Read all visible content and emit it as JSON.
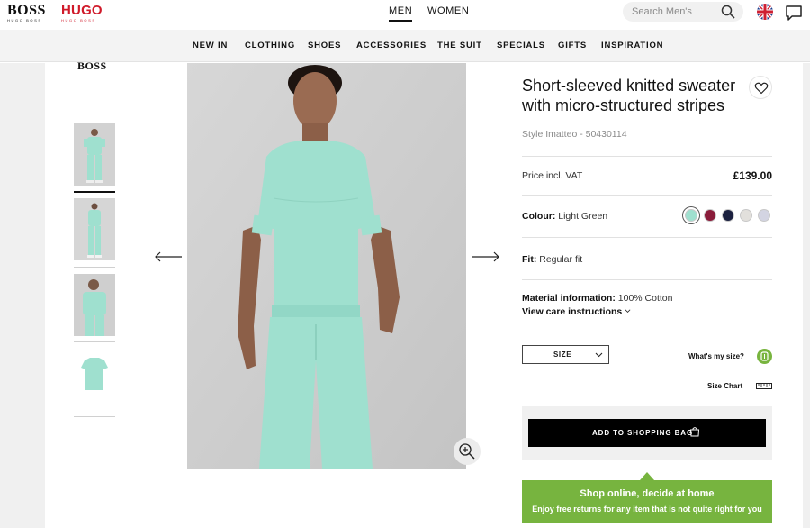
{
  "header": {
    "brand_boss": "BOSS",
    "brand_boss_sub": "HUGO BOSS",
    "brand_hugo": "HUGO",
    "brand_hugo_sub": "HUGO BOSS",
    "gender_tabs": [
      {
        "label": "MEN",
        "active": true
      },
      {
        "label": "WOMEN",
        "active": false
      }
    ],
    "search": {
      "placeholder": "Search Men's",
      "icon": "search-icon"
    },
    "language_icon": "uk-flag-icon",
    "chat_icon": "chat-icon"
  },
  "category_nav": {
    "items": [
      "NEW IN",
      "CLOTHING",
      "SHOES",
      "ACCESSORIES",
      "THE SUIT",
      "SPECIALS",
      "GIFTS",
      "INSPIRATION"
    ]
  },
  "gallery": {
    "mini_logo": "BOSS",
    "thumbnails": [
      "front-full",
      "front-full-2",
      "front-crop",
      "product-flat"
    ],
    "active_thumbnail": 1,
    "prev_icon": "arrow-left-icon",
    "next_icon": "arrow-right-icon",
    "zoom_icon": "zoom-in-icon"
  },
  "product": {
    "title": "Short-sleeved knitted sweater with micro-structured stripes",
    "style": "Style Imatteo - 50430114",
    "price_label": "Price incl. VAT",
    "price": "£139.00",
    "colour_label": "Colour:",
    "colour_value": "Light Green",
    "swatches": [
      "#9fe0cf",
      "#8a1c3a",
      "#1c2140",
      "#e2e0dc",
      "#d3d4e2"
    ],
    "fit_label": "Fit:",
    "fit_value": "Regular fit",
    "material_label": "Material information:",
    "material_value": "100% Cotton",
    "care_link": "View care instructions",
    "size_select": "SIZE",
    "whats_my_size": "What's my size?",
    "size_chart": "Size Chart",
    "add_to_bag": "ADD TO SHOPPING BAG",
    "promo_title": "Shop online, decide at home",
    "promo_text": "Enjoy free returns for any item that is not quite right for you"
  },
  "colors": {
    "accent_green": "#77b43f",
    "hugo_red": "#d01a2a",
    "garment_mint": "#9fe0cf"
  }
}
